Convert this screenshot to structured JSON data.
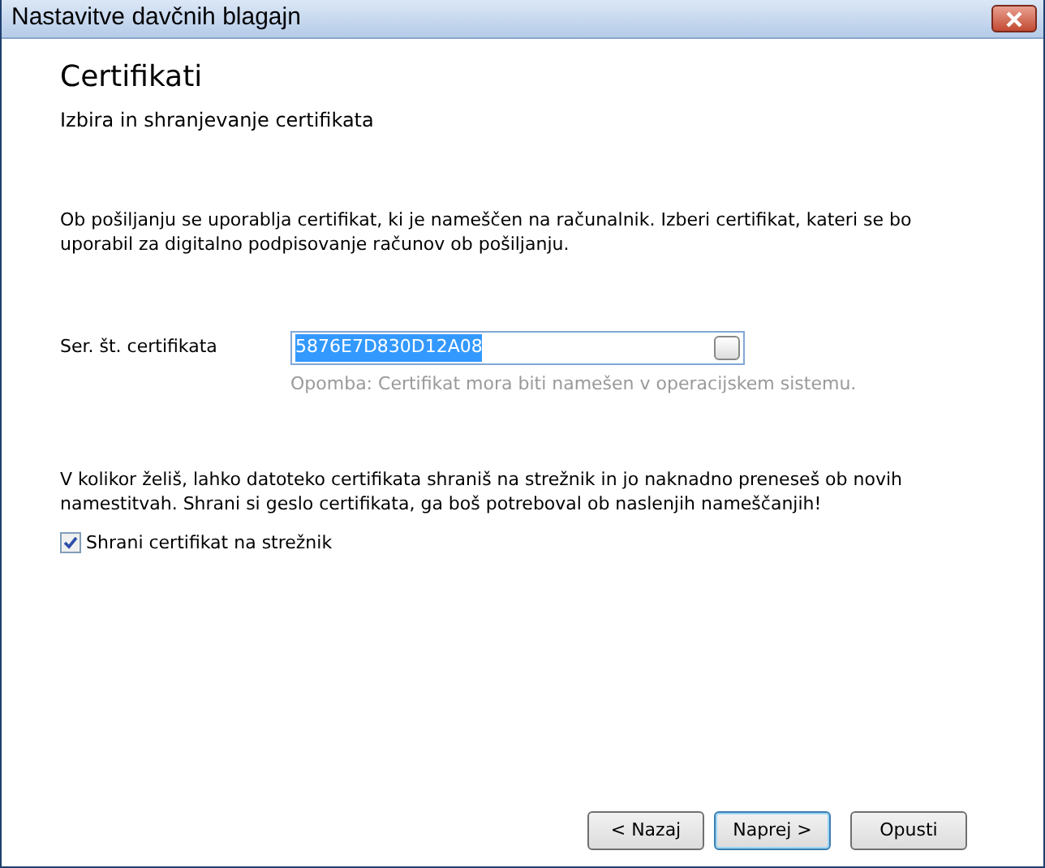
{
  "window": {
    "title": "Nastavitve davčnih blagajn"
  },
  "header": {
    "title": "Certifikati",
    "subtitle": "Izbira in shranjevanje certifikata"
  },
  "intro": "Ob pošiljanju se uporablja certifikat, ki je nameščen na računalnik. Izberi certifikat, kateri se bo uporabil za digitalno podpisovanje računov ob pošiljanju.",
  "certificate_field": {
    "label": "Ser. št. certifikata",
    "value": "5876E7D830D12A08",
    "selected": true,
    "note": "Opomba: Certifikat mora biti namešen v operacijskem sistemu."
  },
  "server_note": "V kolikor želiš, lahko datoteko certifikata shraniš na strežnik in jo naknadno preneseš ob novih namestitvah. Shrani si geslo certifikata, ga boš potreboval ob naslenjih nameščanjih!",
  "save_checkbox": {
    "label": "Shrani certifikat na strežnik",
    "checked": true
  },
  "buttons": [
    {
      "label": "< Nazaj",
      "default": false
    },
    {
      "label": "Naprej >",
      "default": true
    },
    {
      "label": "Opusti",
      "default": false
    }
  ]
}
